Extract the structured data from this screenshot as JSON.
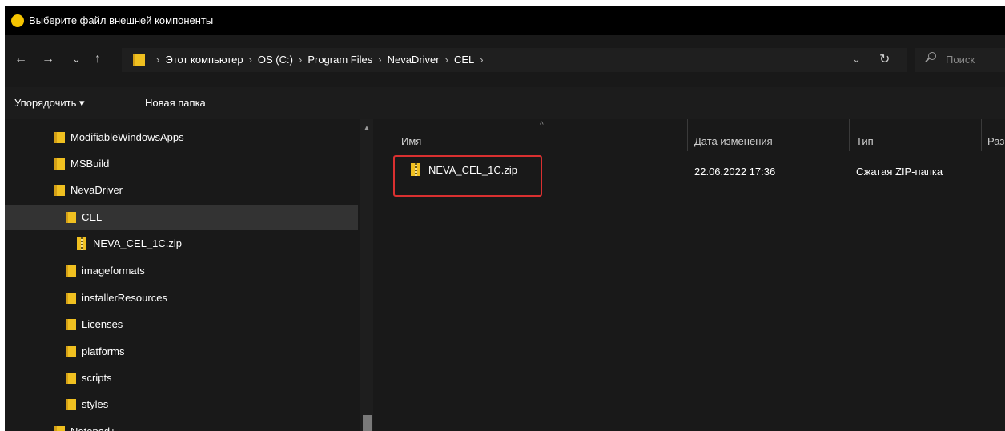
{
  "window": {
    "title": "Выберите файл внешней компоненты"
  },
  "nav": {
    "back": "←",
    "forward": "→",
    "recent": "⌄",
    "up": "↑",
    "refresh": "↻",
    "dropdown": "⌄"
  },
  "breadcrumb": {
    "separator": "›",
    "items": [
      "Этот компьютер",
      "OS (C:)",
      "Program Files",
      "NevaDriver",
      "CEL"
    ]
  },
  "search": {
    "placeholder": "Поиск"
  },
  "toolbar": {
    "organize": "Упорядочить ▾",
    "new_folder": "Новая папка"
  },
  "sidebar": {
    "items": [
      {
        "label": "ModifiableWindowsApps",
        "icon": "folder-icon"
      },
      {
        "label": "MSBuild",
        "icon": "folder-icon"
      },
      {
        "label": "NevaDriver",
        "icon": "folder-icon"
      },
      {
        "label": "CEL",
        "icon": "folder-icon",
        "selected": true
      },
      {
        "label": "NEVA_CEL_1C.zip",
        "icon": "zip-icon"
      },
      {
        "label": "imageformats",
        "icon": "folder-icon"
      },
      {
        "label": "installerResources",
        "icon": "folder-icon"
      },
      {
        "label": "Licenses",
        "icon": "folder-icon"
      },
      {
        "label": "platforms",
        "icon": "folder-icon"
      },
      {
        "label": "scripts",
        "icon": "folder-icon"
      },
      {
        "label": "styles",
        "icon": "folder-icon"
      },
      {
        "label": "Notepad++",
        "icon": "folder-icon"
      }
    ]
  },
  "columns": {
    "name": "Имя",
    "date": "Дата изменения",
    "type": "Тип",
    "size": "Раз"
  },
  "files": [
    {
      "name": "NEVA_CEL_1C.zip",
      "date": "22.06.2022 17:36",
      "type": "Сжатая ZIP-папка",
      "icon": "zip-icon",
      "highlighted": true
    }
  ],
  "colors": {
    "background": "#191919",
    "titlebar": "#000000",
    "selected": "#333333",
    "folder": "#f0c020",
    "highlight_border": "#d93030",
    "title_icon": "#f5c400"
  }
}
